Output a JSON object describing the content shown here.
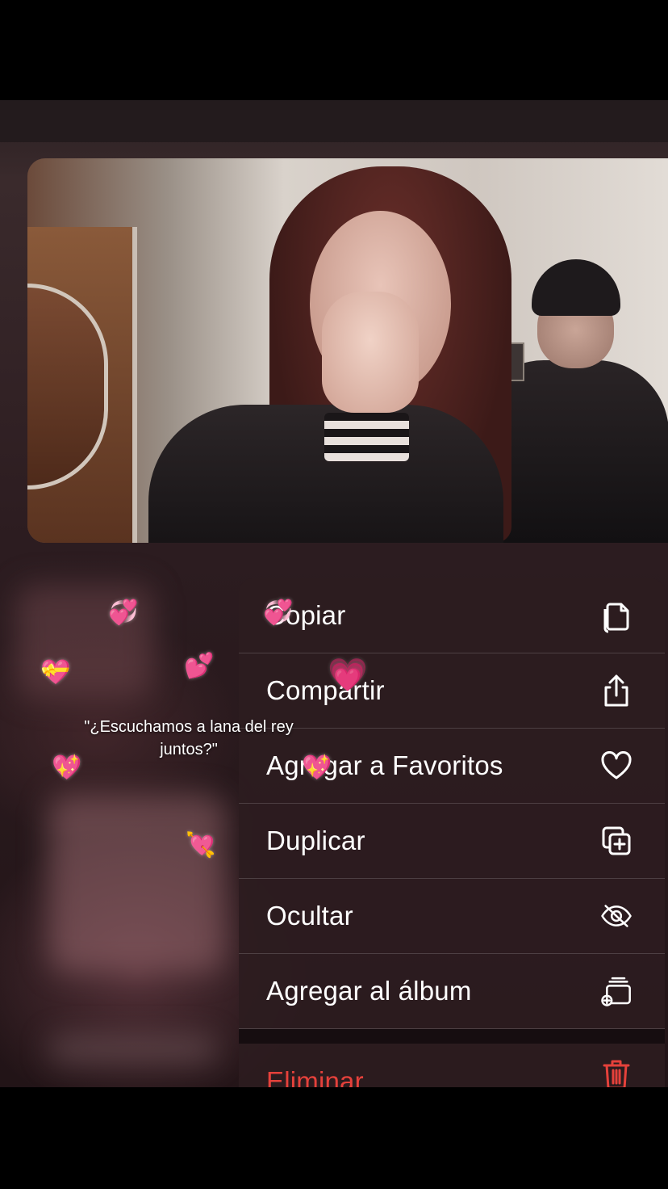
{
  "caption": {
    "line1": "\"¿Escuchamos a lana del rey",
    "line2": "juntos?\""
  },
  "menu": {
    "items": [
      {
        "label": "Copiar",
        "icon": "copy-icon"
      },
      {
        "label": "Compartir",
        "icon": "share-icon"
      },
      {
        "label": "Agregar a Favoritos",
        "icon": "heart-icon"
      },
      {
        "label": "Duplicar",
        "icon": "duplicate-icon"
      },
      {
        "label": "Ocultar",
        "icon": "eye-slash-icon"
      },
      {
        "label": "Agregar al álbum",
        "icon": "add-to-album-icon"
      }
    ],
    "delete": {
      "label": "Eliminar",
      "icon": "trash-icon"
    }
  },
  "colors": {
    "menu_text": "#ffffff",
    "danger": "#e5413b",
    "heart": "#ff3fa4"
  }
}
